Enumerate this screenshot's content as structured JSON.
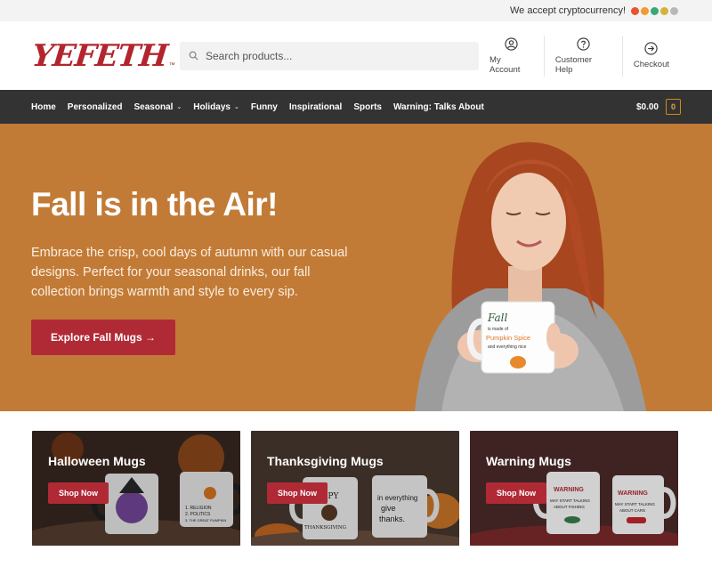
{
  "topbar": {
    "crypto_text": "We accept cryptocurrency!"
  },
  "brand": {
    "logo_text": "YEFETH",
    "logo_tm": "™",
    "accent": "#b02a36"
  },
  "search": {
    "placeholder": "Search products..."
  },
  "header_links": [
    {
      "label": "My Account",
      "icon": "user-circle-icon"
    },
    {
      "label": "Customer Help",
      "icon": "question-circle-icon"
    },
    {
      "label": "Checkout",
      "icon": "arrow-circle-icon"
    }
  ],
  "nav": {
    "items": [
      {
        "label": "Home"
      },
      {
        "label": "Personalized"
      },
      {
        "label": "Seasonal"
      },
      {
        "label": "Holidays"
      },
      {
        "label": "Funny"
      },
      {
        "label": "Inspirational"
      },
      {
        "label": "Sports"
      },
      {
        "label": "Warning: Talks About"
      }
    ],
    "cart_total": "$0.00",
    "cart_count": "0"
  },
  "hero": {
    "title": "Fall is in the Air!",
    "description": "Embrace the crisp, cool days of autumn with our casual designs. Perfect for your seasonal drinks, our fall collection brings warmth and style to every sip.",
    "button": "Explore Fall Mugs →",
    "background": "#c27b36",
    "mug_text": [
      "Fall",
      "is made of",
      "Pumpkin Spice",
      "and everything nice"
    ]
  },
  "cards": [
    {
      "title": "Halloween Mugs",
      "button": "Shop Now"
    },
    {
      "title": "Thanksgiving Mugs",
      "button": "Shop Now"
    },
    {
      "title": "Warning Mugs",
      "button": "Shop Now"
    }
  ],
  "card_mug_text": {
    "halloween": [
      "1. RELIGION",
      "2. POLITICS",
      "3. THE GREAT PUMPKIN"
    ],
    "thanksgiving": [
      "HAPPY",
      "THANKSGIVING",
      "in everything",
      "give",
      "thanks."
    ],
    "warning": [
      "WARNING",
      "MAY START TALKING",
      "ABOUT FISHING",
      "WARNING",
      "MAY START TALKING",
      "ABOUT CARS"
    ]
  }
}
